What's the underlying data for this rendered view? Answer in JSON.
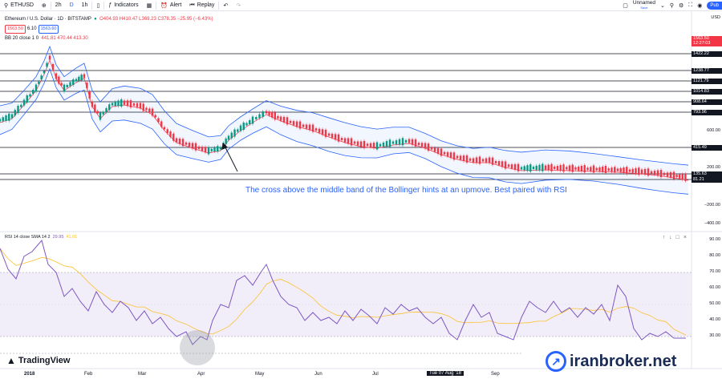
{
  "toolbar": {
    "symbol": "ETHUSD",
    "intervals": [
      "2h",
      "D",
      "1h"
    ],
    "indicators_label": "Indicators",
    "alert_label": "Alert",
    "replay_label": "Replay",
    "layout_name": "Unnamed",
    "layout_status": "Save",
    "publish_label": "Pub"
  },
  "legend": {
    "title": "Ethereum / U.S. Dollar · 1D · BITSTAMP",
    "ohlc": "O404.93 H410.47 L369.23 C378.35 −25.95 (−6.43%)",
    "price_box_1": "1563.50",
    "price_box_mid": "6.10",
    "price_box_2": "1563.60",
    "bb_label": "BB 20 close 1 0",
    "bb_values": "441.81 470.44 413.30"
  },
  "price_axis": {
    "currency": "USD",
    "labels": [
      "600.00",
      "200.00",
      "−200.00",
      "−400.00"
    ],
    "current_price": "1563.50",
    "current_sub": "12:27:03"
  },
  "hlines": [
    {
      "label": "1422.22",
      "price": 1422.22
    },
    {
      "label": "1238.77",
      "price": 1238.77
    },
    {
      "label": "1121.79",
      "price": 1121.79
    },
    {
      "label": "1014.83",
      "price": 1014.83
    },
    {
      "label": "908.64",
      "price": 908.64
    },
    {
      "label": "793.96",
      "price": 793.96
    },
    {
      "label": "415.49",
      "price": 415.49
    },
    {
      "label": "135.63",
      "price": 135.63
    },
    {
      "label": "81.21",
      "price": 81.21
    }
  ],
  "annotation_text": "The cross above the middle band of the Bollinger hints at an upmove. Best paired with RSI",
  "rsi": {
    "label": "RSI 14 close SMA 14 2",
    "value1": "29.95",
    "value2": "41.01",
    "axis_labels": [
      "90.00",
      "80.00",
      "70.00",
      "60.00",
      "50.00",
      "40.00",
      "30.00"
    ],
    "band_upper": 70,
    "band_lower": 30
  },
  "dates": {
    "labels": [
      "2018",
      "Feb",
      "Mar",
      "Apr",
      "May",
      "Jun",
      "Jul",
      "Tue 07 Aug '18",
      "Sep"
    ]
  },
  "branding": {
    "tradingview": "TradingView",
    "watermark": "iranbroker.net"
  },
  "colors": {
    "bb_band": "#2962ff",
    "bb_basis": "#f23645",
    "rsi_line": "#7e57c2",
    "rsi_ma": "#fbc02d",
    "rsi_zone": "#ede7f6",
    "candle_up": "#089981",
    "candle_down": "#f23645"
  }
}
